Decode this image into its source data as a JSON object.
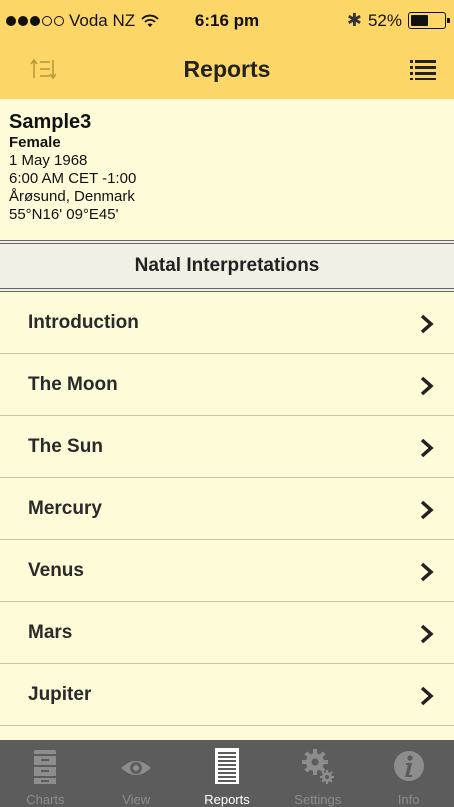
{
  "status_bar": {
    "carrier": "Voda NZ",
    "signal_strength": 3,
    "signal_max": 5,
    "time": "6:16 pm",
    "battery_text": "52%",
    "battery_level": 0.52
  },
  "nav": {
    "title": "Reports",
    "left_icon": "sort-icon",
    "right_icon": "list-icon"
  },
  "profile": {
    "name": "Sample3",
    "gender": "Female",
    "date": "1 May 1968",
    "time": "6:00 AM CET -1:00",
    "place": "Årøsund, Denmark",
    "coords": "55°N16' 09°E45'"
  },
  "section": {
    "title": "Natal Interpretations"
  },
  "items": [
    {
      "label": "Introduction"
    },
    {
      "label": "The Moon"
    },
    {
      "label": "The Sun"
    },
    {
      "label": "Mercury"
    },
    {
      "label": "Venus"
    },
    {
      "label": "Mars"
    },
    {
      "label": "Jupiter"
    },
    {
      "label": ""
    }
  ],
  "tabs": [
    {
      "label": "Charts",
      "icon": "cabinet-icon",
      "active": false
    },
    {
      "label": "View",
      "icon": "eye-icon",
      "active": false
    },
    {
      "label": "Reports",
      "icon": "document-icon",
      "active": true
    },
    {
      "label": "Settings",
      "icon": "gear-icon",
      "active": false
    },
    {
      "label": "Info",
      "icon": "info-icon",
      "active": false
    }
  ],
  "colors": {
    "header_bg": "#fdd668",
    "panel_bg": "#fefbd9",
    "section_bg": "#f2f0e4",
    "tabbar_bg": "#5c5c5c",
    "tab_icon_inactive": "#8d8d8d",
    "tab_icon_active": "#ffffff"
  }
}
